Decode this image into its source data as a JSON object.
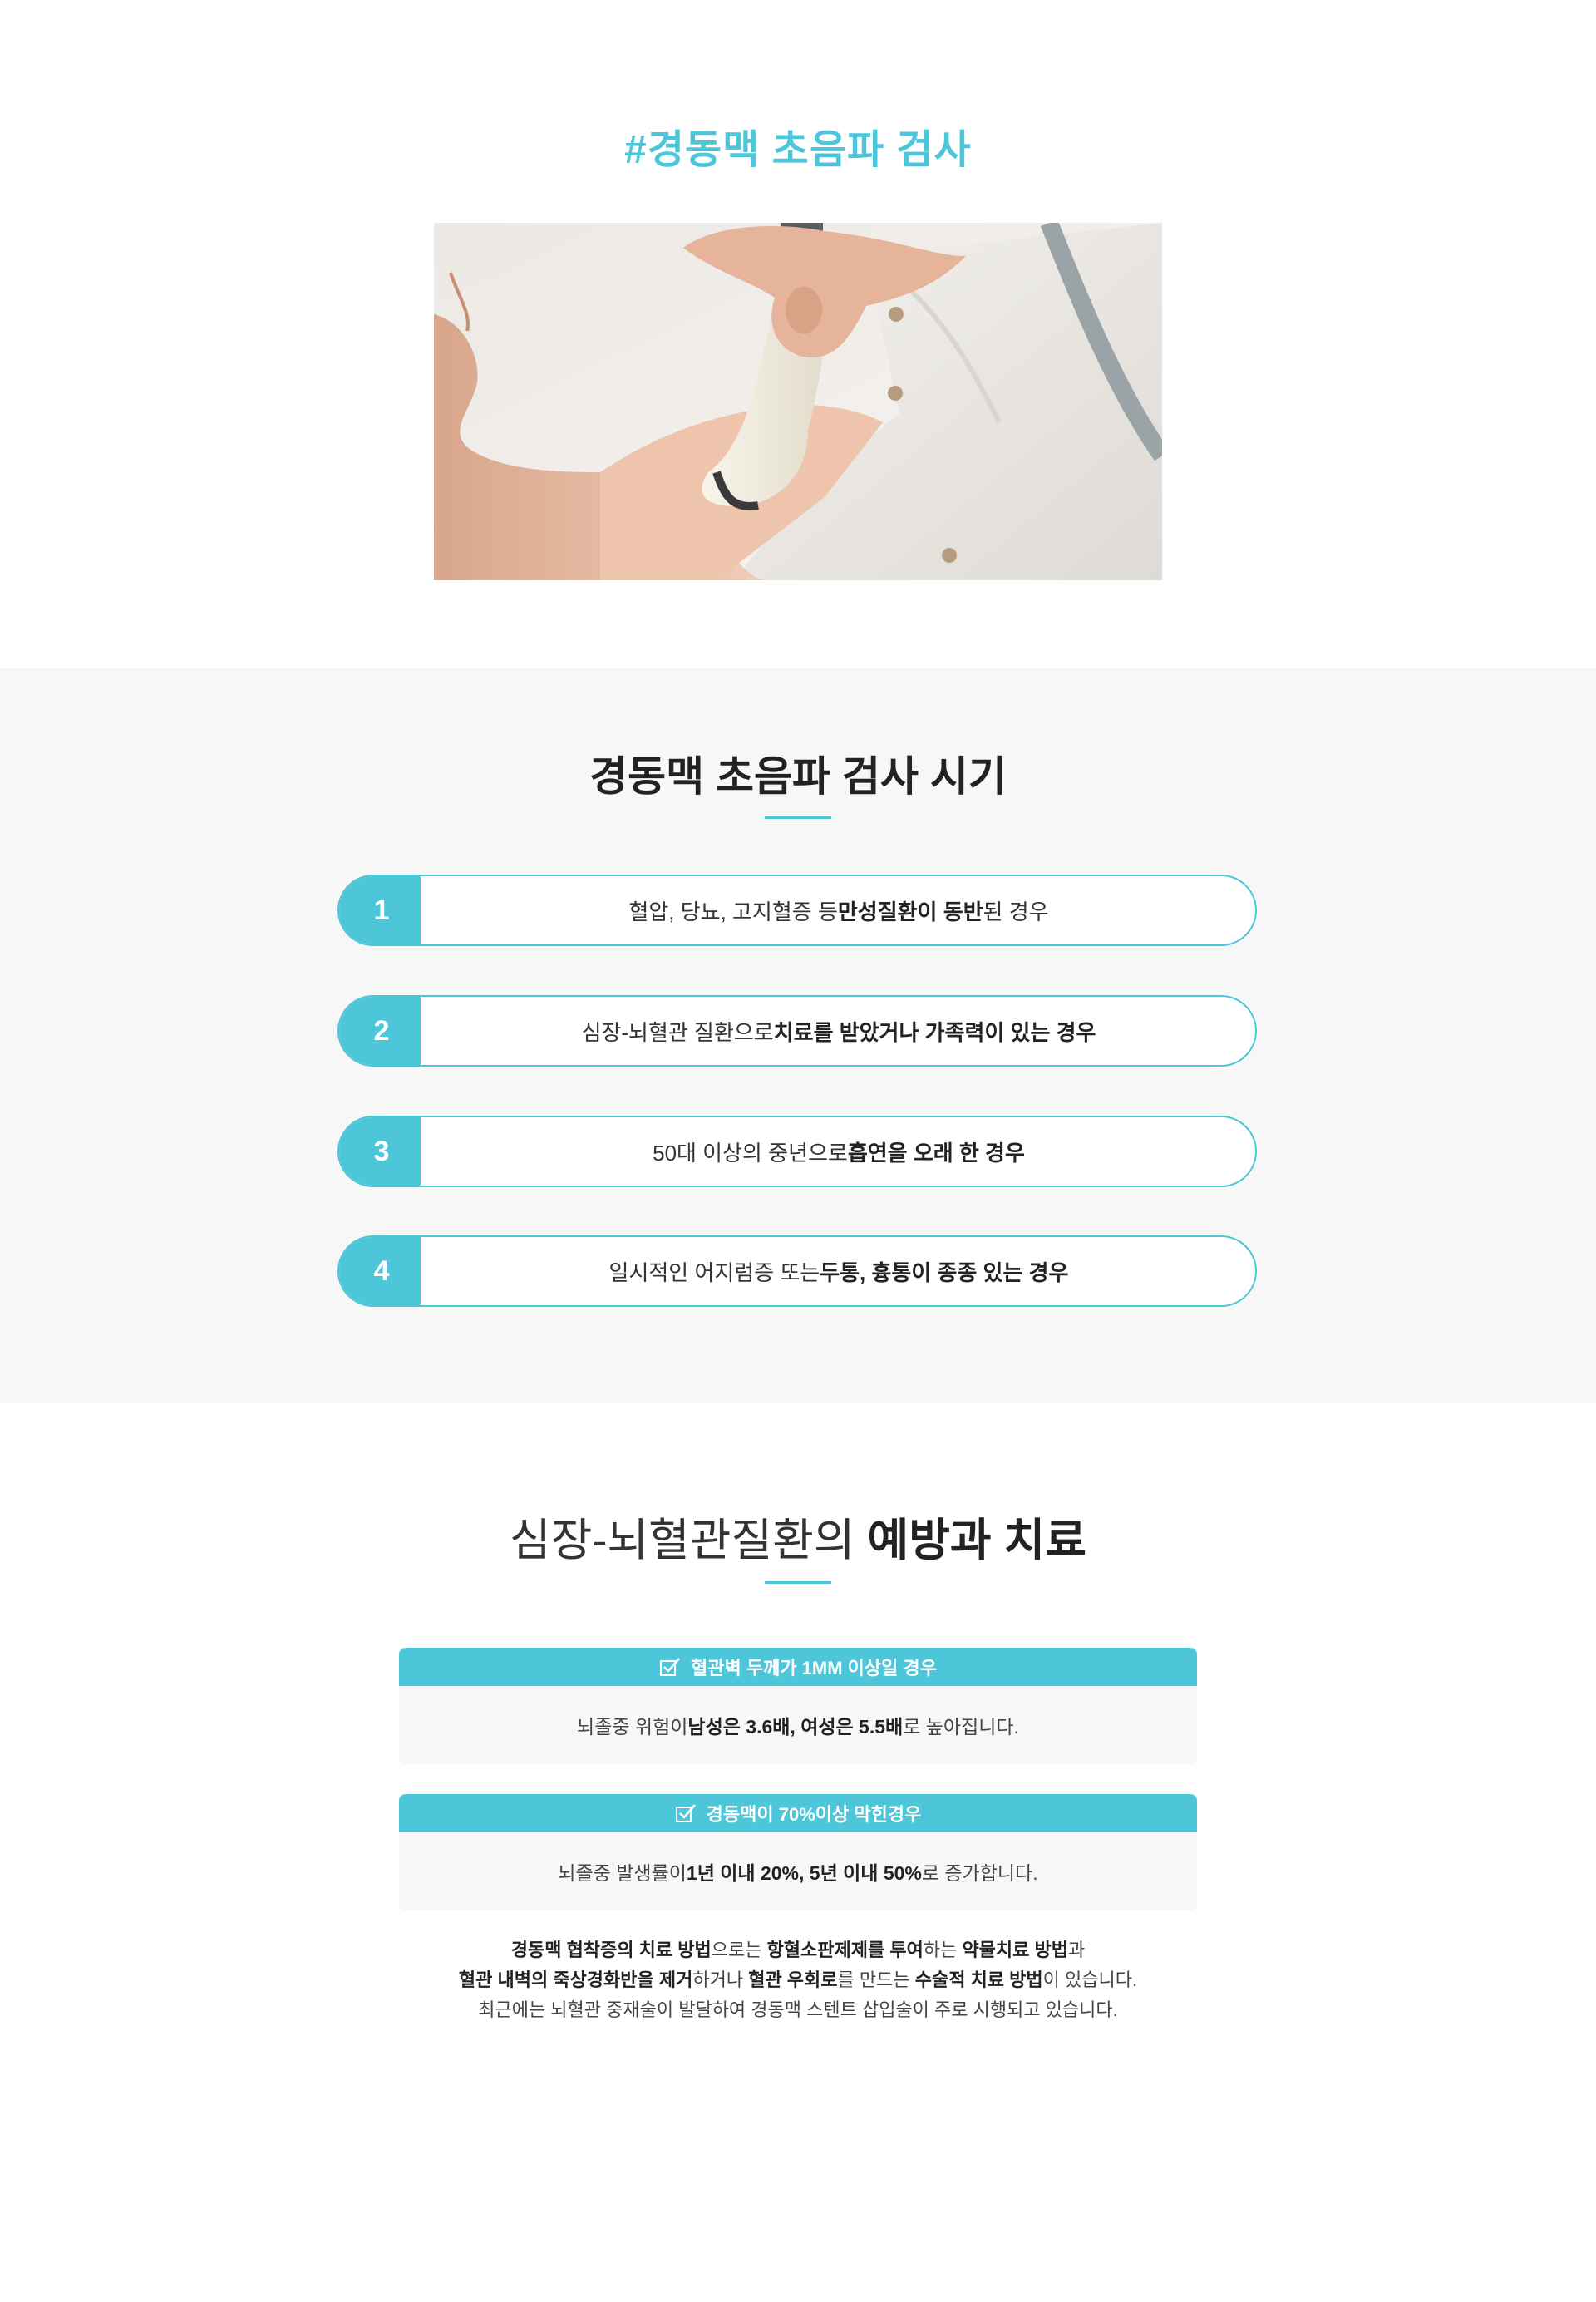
{
  "header": {
    "hashtag_title": "#경동맥 초음파 검사"
  },
  "timing": {
    "title": "경동맥 초음파 검사 시기",
    "items": [
      {
        "num": "1",
        "normal": "혈압, 당뇨, 고지혈증 등 ",
        "bold": "만성질환이 동반",
        "after": "된 경우"
      },
      {
        "num": "2",
        "normal": "심장-뇌혈관 질환으로 ",
        "bold": "치료를 받았거나 가족력이 있는 경우",
        "after": ""
      },
      {
        "num": "3",
        "normal": "50대 이상의 중년으로 ",
        "bold": "흡연을 오래 한 경우",
        "after": ""
      },
      {
        "num": "4",
        "normal": "일시적인 어지럼증 또는 ",
        "bold": "두통, 흉통이 종종 있는 경우",
        "after": ""
      }
    ]
  },
  "prevention": {
    "title_light": "심장-뇌혈관질환의 ",
    "title_bold": "예방과 치료",
    "cards": [
      {
        "header": "혈관벽 두께가 1MM 이상일 경우",
        "body_prefix": "뇌졸중 위험이 ",
        "body_bold1": "남성은 3.6배, 여성은 5.5배",
        "body_suffix": "로 높아집니다."
      },
      {
        "header": "경동맥이 70%이상 막힌경우",
        "body_prefix": "뇌졸중 발생률이 ",
        "body_bold1": "1년 이내 20%, 5년 이내 50%",
        "body_suffix": "로 증가합니다."
      }
    ],
    "summary": {
      "l1a": "경동맥 협착증의 치료 방법",
      "l1b": "으로는 ",
      "l1c": "항혈소판제제를 투여",
      "l1d": "하는 ",
      "l1e": "약물치료 방법",
      "l1f": "과",
      "l2a": "혈관 내벽의 죽상경화반을 제거",
      "l2b": "하거나 ",
      "l2c": "혈관 우회로",
      "l2d": "를 만드는 ",
      "l2e": "수술적 치료 방법",
      "l2f": "이 있습니다.",
      "l3": "최근에는 뇌혈관 중재술이 발달하여 경동맥 스텐트 삽입술이 주로 시행되고 있습니다."
    }
  },
  "colors": {
    "accent": "#4dc6d9",
    "gray_bg": "#f7f7f7",
    "text_dark": "#222222"
  },
  "icons": {
    "card_check": "checkbox-check-icon"
  }
}
